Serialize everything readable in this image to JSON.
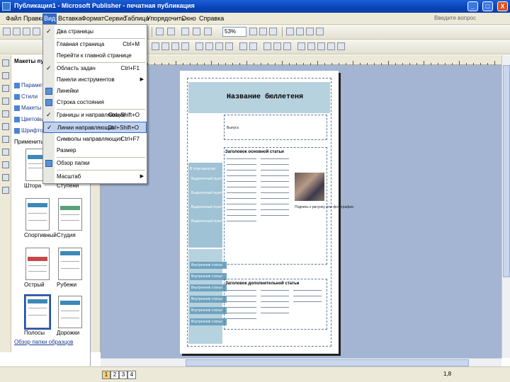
{
  "window": {
    "title": "Публикация1 - Microsoft Publisher - печатная публикация",
    "minimize": "_",
    "maximize": "□",
    "close": "X"
  },
  "menubar": {
    "items": [
      "Файл",
      "Правка",
      "Вид",
      "Вставка",
      "Формат",
      "Сервис",
      "Таблица",
      "Упорядочить",
      "Окно",
      "Справка"
    ],
    "help_placeholder": "Введите вопрос"
  },
  "toolbar": {
    "zoom": "53%"
  },
  "view_menu": {
    "items": [
      {
        "label": "Два страницы",
        "shortcut": "",
        "check": true,
        "icon": false,
        "arrow": false,
        "highlight": false
      },
      {
        "label": "Главная страница",
        "shortcut": "Ctrl+M",
        "check": false,
        "icon": false,
        "arrow": false,
        "highlight": false
      },
      {
        "label": "Перейти к главной странице",
        "shortcut": "",
        "check": false,
        "icon": false,
        "arrow": false,
        "highlight": false
      },
      {
        "label": "Область задач",
        "shortcut": "Ctrl+F1",
        "check": true,
        "icon": false,
        "arrow": false,
        "highlight": false
      },
      {
        "label": "Панели инструментов",
        "shortcut": "",
        "check": false,
        "icon": false,
        "arrow": true,
        "highlight": false
      },
      {
        "label": "Линейки",
        "shortcut": "",
        "check": false,
        "icon": true,
        "arrow": false,
        "highlight": false
      },
      {
        "label": "Строка состояния",
        "shortcut": "",
        "check": false,
        "icon": true,
        "arrow": false,
        "highlight": false
      },
      {
        "label": "Границы и направляющие",
        "shortcut": "Ctrl+Shift+O",
        "check": true,
        "icon": false,
        "arrow": false,
        "highlight": false
      },
      {
        "label": "Линии направляющих",
        "shortcut": "Ctrl+Shift+O",
        "check": true,
        "icon": false,
        "arrow": false,
        "highlight": true
      },
      {
        "label": "Символы направляющих",
        "shortcut": "Ctrl+F7",
        "check": false,
        "icon": false,
        "arrow": false,
        "highlight": false
      },
      {
        "label": "Размер",
        "shortcut": "",
        "check": false,
        "icon": false,
        "arrow": false,
        "highlight": false
      },
      {
        "label": "Обзор папки",
        "shortcut": "",
        "check": false,
        "icon": true,
        "arrow": false,
        "highlight": false
      },
      {
        "label": "Масштаб",
        "shortcut": "",
        "check": false,
        "icon": false,
        "arrow": true,
        "highlight": false
      }
    ]
  },
  "taskpane": {
    "header": "Макеты публикаций",
    "items": [
      "Параметры",
      "Стили",
      "Макеты",
      "Цветовые схемы",
      "Шрифтовые схемы"
    ],
    "apply_label": "Применить макет",
    "thumbs": [
      "Штора",
      "Ступени",
      "Спортивный",
      "Студия",
      "Острый",
      "Рубежи",
      "Полосы",
      "Дорожки"
    ],
    "link": "Обзор папки образцов"
  },
  "document": {
    "title": "Название бюллетеня",
    "issue": "Выпуск",
    "story1": "Заголовок основной статьи",
    "story2": "Заголовок дополнительной статьи",
    "caption": "Подпись к рисунку или фотографии",
    "inside": "В этом выпуске:",
    "side_rows": [
      "Внутренняя статья",
      "Внутренняя статья",
      "Внутренняя статья",
      "Внутренняя статья",
      "Внутренняя статья",
      "Внутренняя статья"
    ],
    "bullets": [
      "Выделенный пункт",
      "Выделенный пункт",
      "Выделенный пункт",
      "Выделенный пункт"
    ]
  },
  "statusbar": {
    "pages": [
      "1",
      "2",
      "3",
      "4"
    ],
    "coord": "1,8"
  }
}
